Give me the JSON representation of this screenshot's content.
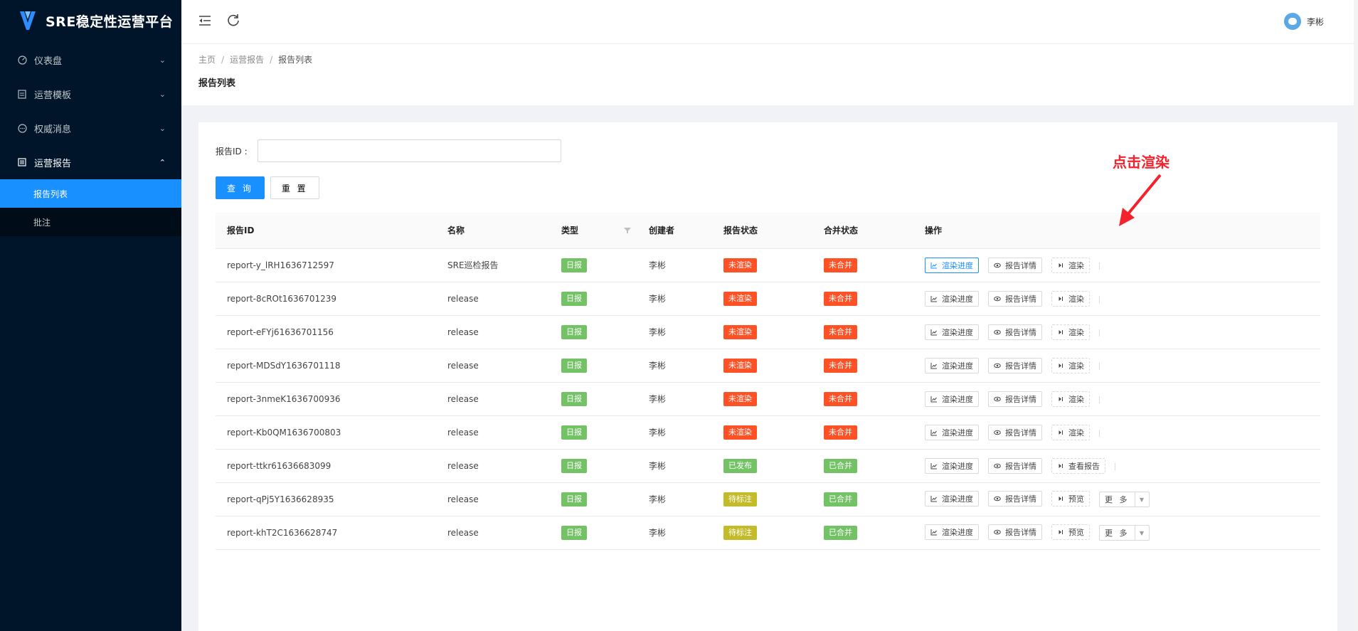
{
  "app": {
    "title": "SRE稳定性运营平台"
  },
  "sidebar": {
    "items": [
      {
        "label": "仪表盘",
        "icon": "dashboard-icon"
      },
      {
        "label": "运营模板",
        "icon": "file-icon"
      },
      {
        "label": "权威消息",
        "icon": "message-icon"
      },
      {
        "label": "运营报告",
        "icon": "report-icon"
      }
    ],
    "subitems": [
      {
        "label": "报告列表",
        "active": true
      },
      {
        "label": "批注",
        "active": false
      }
    ]
  },
  "header": {
    "user_name": "李彬"
  },
  "breadcrumb": {
    "home": "主页",
    "section": "运营报告",
    "current": "报告列表"
  },
  "page_title": "报告列表",
  "search": {
    "label": "报告ID :",
    "value": "",
    "query_label": "查 询",
    "reset_label": "重 置"
  },
  "annotation": {
    "text": "点击渲染",
    "color": "#f5222d"
  },
  "table": {
    "columns": [
      "报告ID",
      "名称",
      "类型",
      "创建者",
      "报告状态",
      "合并状态",
      "操作"
    ],
    "rows": [
      {
        "id": "report-y_lRH1636712597",
        "name": "SRE巡检报告",
        "type": "日报",
        "creator": "李彬",
        "status": "未渲染",
        "status_color": "red",
        "merge": "未合并",
        "merge_color": "red",
        "ops": [
          "渲染进度",
          "报告详情",
          "渲染"
        ],
        "highlight": true
      },
      {
        "id": "report-8cROt1636701239",
        "name": "release",
        "type": "日报",
        "creator": "李彬",
        "status": "未渲染",
        "status_color": "red",
        "merge": "未合并",
        "merge_color": "red",
        "ops": [
          "渲染进度",
          "报告详情",
          "渲染"
        ]
      },
      {
        "id": "report-eFYj61636701156",
        "name": "release",
        "type": "日报",
        "creator": "李彬",
        "status": "未渲染",
        "status_color": "red",
        "merge": "未合并",
        "merge_color": "red",
        "ops": [
          "渲染进度",
          "报告详情",
          "渲染"
        ]
      },
      {
        "id": "report-MDSdY1636701118",
        "name": "release",
        "type": "日报",
        "creator": "李彬",
        "status": "未渲染",
        "status_color": "red",
        "merge": "未合并",
        "merge_color": "red",
        "ops": [
          "渲染进度",
          "报告详情",
          "渲染"
        ]
      },
      {
        "id": "report-3nmeK1636700936",
        "name": "release",
        "type": "日报",
        "creator": "李彬",
        "status": "未渲染",
        "status_color": "red",
        "merge": "未合并",
        "merge_color": "red",
        "ops": [
          "渲染进度",
          "报告详情",
          "渲染"
        ]
      },
      {
        "id": "report-Kb0QM1636700803",
        "name": "release",
        "type": "日报",
        "creator": "李彬",
        "status": "未渲染",
        "status_color": "red",
        "merge": "未合并",
        "merge_color": "red",
        "ops": [
          "渲染进度",
          "报告详情",
          "渲染"
        ]
      },
      {
        "id": "report-ttkr61636683099",
        "name": "release",
        "type": "日报",
        "creator": "李彬",
        "status": "已发布",
        "status_color": "green",
        "merge": "已合并",
        "merge_color": "green",
        "ops": [
          "渲染进度",
          "报告详情",
          "查看报告"
        ]
      },
      {
        "id": "report-qPj5Y1636628935",
        "name": "release",
        "type": "日报",
        "creator": "李彬",
        "status": "待标注",
        "status_color": "olive",
        "merge": "已合并",
        "merge_color": "green",
        "ops": [
          "渲染进度",
          "报告详情",
          "预览"
        ],
        "more": "更 多"
      },
      {
        "id": "report-khT2C1636628747",
        "name": "release",
        "type": "日报",
        "creator": "李彬",
        "status": "待标注",
        "status_color": "olive",
        "merge": "已合并",
        "merge_color": "green",
        "ops": [
          "渲染进度",
          "报告详情",
          "预览"
        ],
        "more": "更 多"
      }
    ]
  }
}
